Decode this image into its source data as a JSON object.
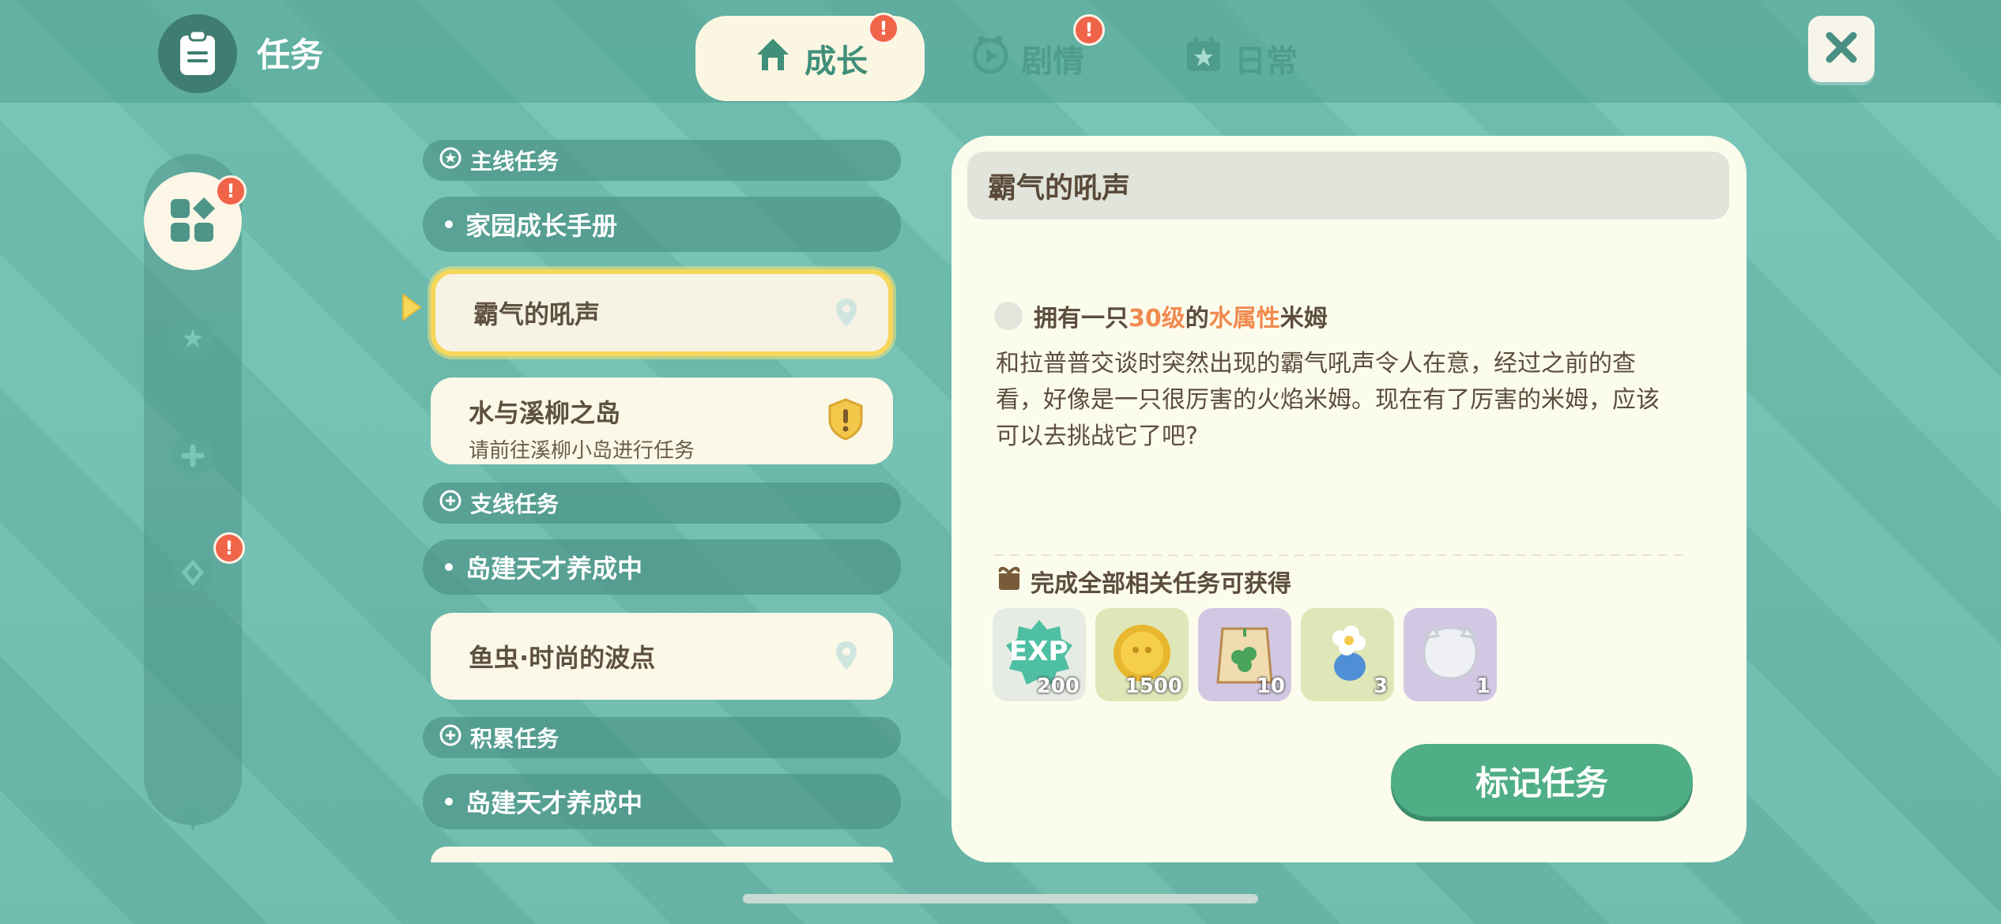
{
  "header": {
    "title": "任务",
    "tabs": [
      {
        "label": "成长",
        "active": true,
        "badge": "!"
      },
      {
        "label": "剧情",
        "active": false,
        "badge": "!"
      },
      {
        "label": "日常",
        "active": false
      }
    ]
  },
  "rail": {
    "items": [
      {
        "icon": "grid-icon",
        "active": true,
        "badge": "!"
      },
      {
        "icon": "star-badge-icon",
        "active": false
      },
      {
        "icon": "plus-badge-icon",
        "active": false
      },
      {
        "icon": "leaf-badge-icon",
        "active": false,
        "badge": "!"
      }
    ]
  },
  "list": {
    "main_section": "主线任务",
    "main_item1": "家园成长手册",
    "selected_item": "霸气的吼声",
    "item_water_title": "水与溪柳之岛",
    "item_water_sub": "请前往溪柳小岛进行任务",
    "side_section": "支线任务",
    "side_item1": "岛建天才养成中",
    "side_item2": "鱼虫·时尚的波点",
    "accum_section": "积累任务",
    "accum_item1": "岛建天才养成中"
  },
  "detail": {
    "title": "霸气的吼声",
    "condition": {
      "prefix": "拥有一只",
      "level": "30级",
      "mid": "的",
      "attr": "水属性",
      "suffix": "米姆"
    },
    "description": "和拉普普交谈时突然出现的霸气吼声令人在意，经过之前的查看，好像是一只很厉害的火焰米姆。现在有了厉害的米姆，应该可以去挑战它了吧?",
    "reward_title": "完成全部相关任务可获得",
    "rewards": [
      {
        "icon": "exp-icon",
        "label": "EXP",
        "qty": "200"
      },
      {
        "icon": "gold-coin-icon",
        "qty": "1500"
      },
      {
        "icon": "seed-packet-icon",
        "qty": "10"
      },
      {
        "icon": "flower-potion-icon",
        "qty": "3"
      },
      {
        "icon": "bubble-cap-icon",
        "qty": "1"
      }
    ],
    "mark_button": "标记任务"
  },
  "colors": {
    "accent": "#4fae86",
    "highlight": "#f08a4e",
    "badge": "#f0644a"
  }
}
